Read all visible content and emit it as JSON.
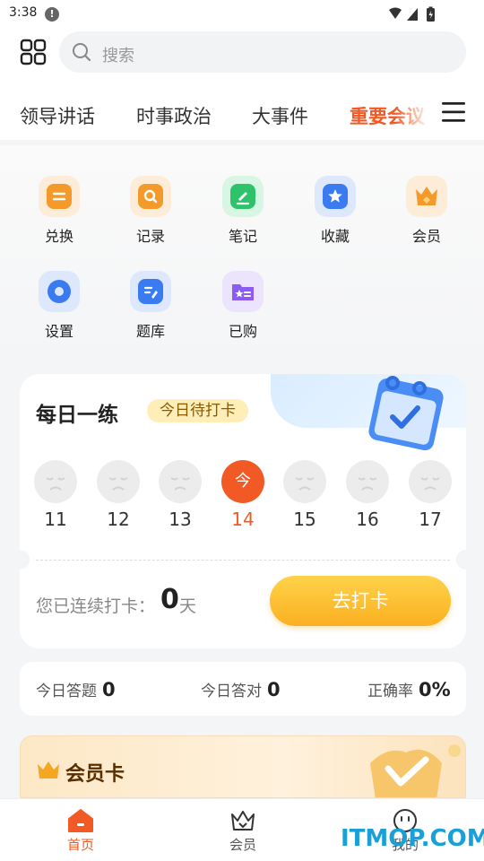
{
  "status": {
    "time": "3:38"
  },
  "search": {
    "placeholder": "搜索"
  },
  "tabs": [
    {
      "label": "领导讲话"
    },
    {
      "label": "时事政治"
    },
    {
      "label": "大事件"
    },
    {
      "label": "重要会议"
    }
  ],
  "shortcuts": [
    {
      "label": "兑换",
      "icon": "exchange-icon",
      "color": "#f39a2b"
    },
    {
      "label": "记录",
      "icon": "record-icon",
      "color": "#f39a2b"
    },
    {
      "label": "笔记",
      "icon": "note-icon",
      "color": "#2ec26a"
    },
    {
      "label": "收藏",
      "icon": "star-icon",
      "color": "#3a7bf2"
    },
    {
      "label": "会员",
      "icon": "crown-icon",
      "color": "#f39a2b"
    },
    {
      "label": "设置",
      "icon": "gear-icon",
      "color": "#3a7bf2"
    },
    {
      "label": "题库",
      "icon": "question-bank-icon",
      "color": "#3a7bf2"
    },
    {
      "label": "已购",
      "icon": "purchased-icon",
      "color": "#8a5cf2"
    }
  ],
  "practice": {
    "title": "每日一练",
    "badge": "今日待打卡",
    "days": [
      {
        "num": "11",
        "face": ""
      },
      {
        "num": "12",
        "face": ""
      },
      {
        "num": "13",
        "face": ""
      },
      {
        "num": "14",
        "face": "今"
      },
      {
        "num": "15",
        "face": ""
      },
      {
        "num": "16",
        "face": ""
      },
      {
        "num": "17",
        "face": ""
      }
    ],
    "streak_label": "您已连续打卡：",
    "streak_value": "0",
    "streak_unit": "天",
    "button": "去打卡"
  },
  "stats": {
    "answered_label": "今日答题",
    "answered_value": "0",
    "correct_label": "今日答对",
    "correct_value": "0",
    "rate_label": "正确率",
    "rate_value": "0%"
  },
  "vip": {
    "title": "会员卡"
  },
  "nav": [
    {
      "label": "首页"
    },
    {
      "label": "会员"
    },
    {
      "label": "我的"
    }
  ],
  "watermark": "ITMOP.COM",
  "colors": {
    "accent": "#f15a24",
    "button": "#fbb021"
  }
}
